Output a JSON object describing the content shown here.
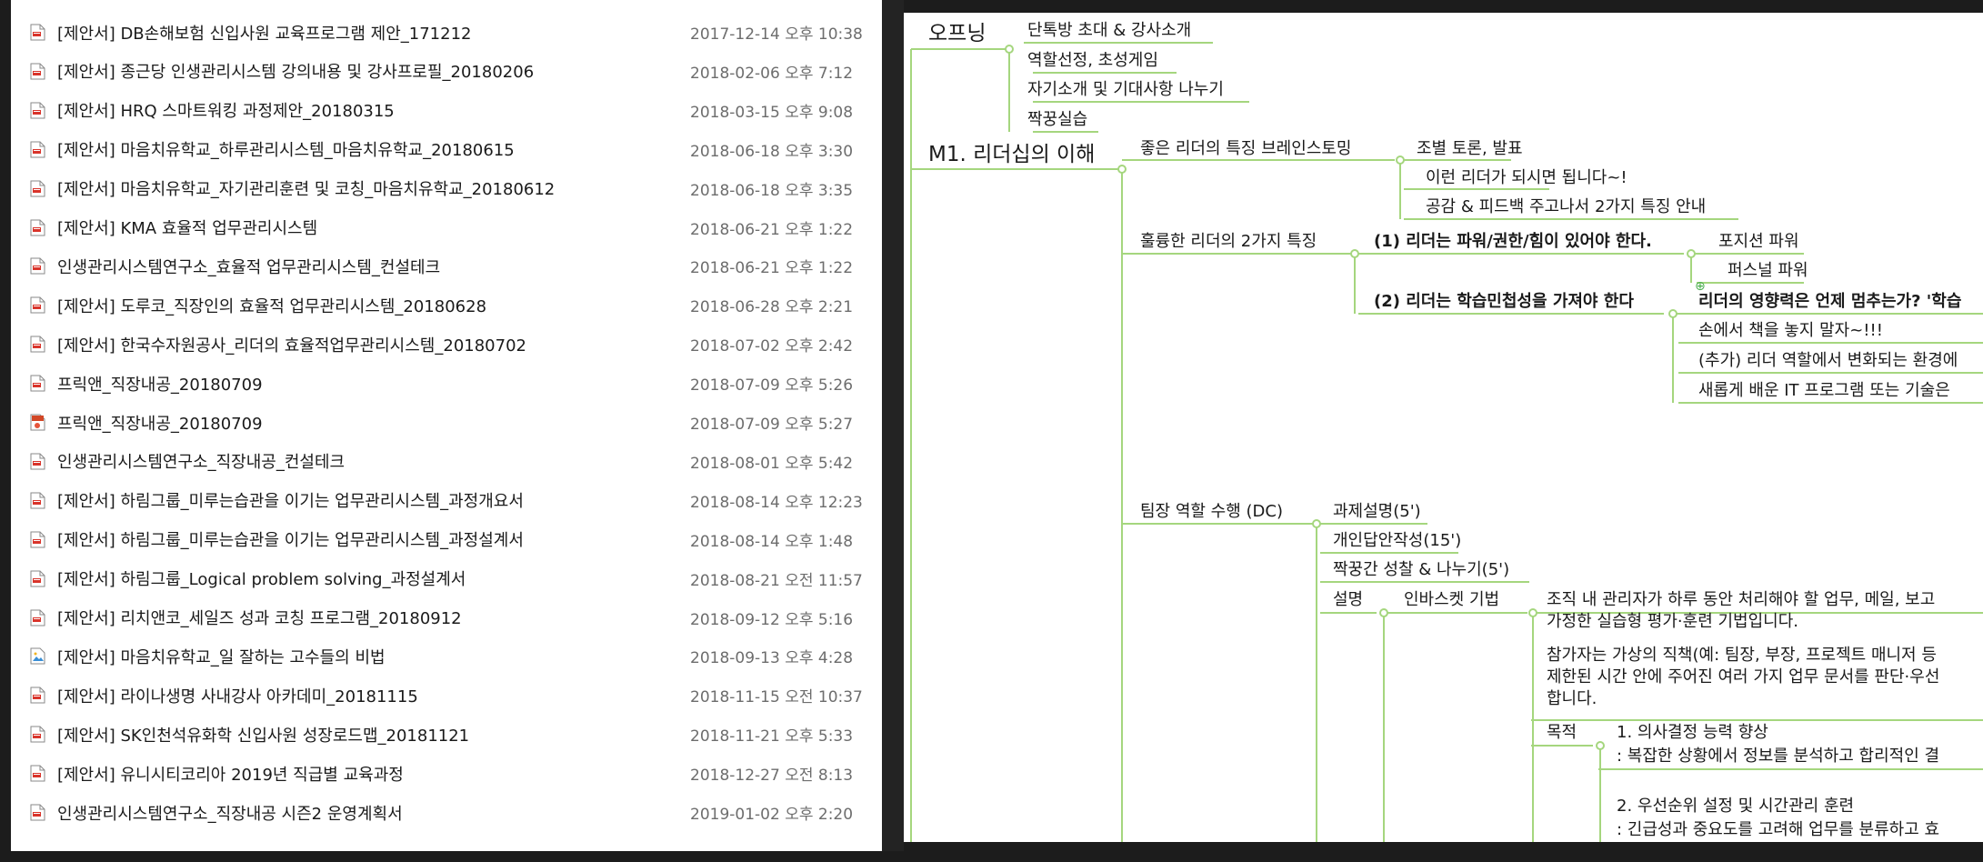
{
  "file_list": [
    {
      "name": "[제안서] DB손해보험 신입사원 교육프로그램 제안_171212",
      "date": "2017-12-14 오후 10:38",
      "icon": "pdf-file-icon"
    },
    {
      "name": "[제안서] 종근당 인생관리시스템 강의내용 및 강사프로필_20180206",
      "date": "2018-02-06 오후 7:12",
      "icon": "pdf-file-icon"
    },
    {
      "name": "[제안서] HRQ 스마트워킹 과정제안_20180315",
      "date": "2018-03-15 오후 9:08",
      "icon": "pdf-file-icon"
    },
    {
      "name": "[제안서] 마음치유학교_하루관리시스템_마음치유학교_20180615",
      "date": "2018-06-18 오후 3:30",
      "icon": "pdf-file-icon"
    },
    {
      "name": "[제안서] 마음치유학교_자기관리훈련 및 코칭_마음치유학교_20180612",
      "date": "2018-06-18 오후 3:35",
      "icon": "pdf-file-icon"
    },
    {
      "name": "[제안서] KMA 효율적 업무관리시스템",
      "date": "2018-06-21 오후 1:22",
      "icon": "pdf-file-icon"
    },
    {
      "name": "인생관리시스템연구소_효율적 업무관리시스템_컨설테크",
      "date": "2018-06-21 오후 1:22",
      "icon": "pdf-file-icon"
    },
    {
      "name": "[제안서] 도루코_직장인의 효율적 업무관리시스템_20180628",
      "date": "2018-06-28 오후 2:21",
      "icon": "pdf-file-icon"
    },
    {
      "name": "[제안서] 한국수자원공사_리더의 효율적업무관리시스템_20180702",
      "date": "2018-07-02 오후 2:42",
      "icon": "pdf-file-icon"
    },
    {
      "name": "프릭앤_직장내공_20180709",
      "date": "2018-07-09 오후 5:26",
      "icon": "pdf-file-icon"
    },
    {
      "name": "프릭앤_직장내공_20180709",
      "date": "2018-07-09 오후 5:27",
      "icon": "ppt-file-icon"
    },
    {
      "name": "인생관리시스템연구소_직장내공_컨설테크",
      "date": "2018-08-01 오후 5:42",
      "icon": "pdf-file-icon"
    },
    {
      "name": "[제안서] 하림그룹_미루는습관을 이기는 업무관리시스템_과정개요서",
      "date": "2018-08-14 오후 12:23",
      "icon": "pdf-file-icon"
    },
    {
      "name": "[제안서] 하림그룹_미루는습관을 이기는 업무관리시스템_과정설계서",
      "date": "2018-08-14 오후 1:48",
      "icon": "pdf-file-icon"
    },
    {
      "name": "[제안서] 하림그룹_Logical problem solving_과정설계서",
      "date": "2018-08-21 오전 11:57",
      "icon": "pdf-file-icon"
    },
    {
      "name": "[제안서] 리치앤코_세일즈 성과 코칭 프로그램_20180912",
      "date": "2018-09-12 오후 5:16",
      "icon": "pdf-file-icon"
    },
    {
      "name": "[제안서] 마음치유학교_일 잘하는 고수들의 비법",
      "date": "2018-09-13 오후 4:28",
      "icon": "image-file-icon"
    },
    {
      "name": "[제안서] 라이나생명 사내강사 아카데미_20181115",
      "date": "2018-11-15 오전 10:37",
      "icon": "pdf-file-icon"
    },
    {
      "name": "[제안서] SK인천석유화학 신입사원 성장로드맵_20181121",
      "date": "2018-11-21 오후 5:33",
      "icon": "pdf-file-icon"
    },
    {
      "name": "[제안서] 유니시티코리아 2019년 직급별 교육과정",
      "date": "2018-12-27 오전 8:13",
      "icon": "pdf-file-icon"
    },
    {
      "name": "인생관리시스템연구소_직장내공 시즌2 운영계획서",
      "date": "2019-01-02 오후 2:20",
      "icon": "pdf-file-icon"
    }
  ],
  "mindmap": {
    "line_color": "#a5d67e",
    "nodes": {
      "opening": "오프닝",
      "opening_c1": "단톡방 초대 & 강사소개",
      "opening_c2": "역할선정, 초성게임",
      "opening_c3": "자기소개 및 기대사항 나누기",
      "opening_c4": "짝꿍실습",
      "m1": "M1. 리더십의 이해",
      "m1_a": "좋은 리더의 특징 브레인스토밍",
      "m1_a1": "조별 토론, 발표",
      "m1_a2": "이런 리더가 되시면 됩니다~!",
      "m1_a3": "공감 & 피드백 주고나서 2가지 특징 안내",
      "m1_b": "훌륭한 리더의 2가지 특징",
      "m1_b1": "(1) 리더는 파워/권한/힘이 있어야 한다.",
      "m1_b1a": "포지션 파워",
      "m1_b1b": "퍼스널 파워",
      "m1_b2": "(2) 리더는 학습민첩성을 가져야 한다",
      "m1_b2a": "리더의 영향력은 언제 멈추는가? '학습",
      "m1_b2b": "손에서 책을 놓지 말자~!!!",
      "m1_b2c": "(추가) 리더 역할에서 변화되는 환경에",
      "m1_b2d": "새롭게 배운 IT 프로그램 또는 기술은",
      "m1_c": "팀장 역할 수행 (DC)",
      "m1_c1": "과제설명(5')",
      "m1_c2": "개인답안작성(15')",
      "m1_c3": "짝꿍간 성찰 & 나누기(5')",
      "m1_c4": "설명",
      "inbasket": "인바스켓 기법",
      "inbasket_d1_l1": "조직 내 관리자가 하루 동안 처리해야 할 업무, 메일, 보고",
      "inbasket_d1_l2": "가정한 실습형 평가·훈련 기법입니다.",
      "inbasket_d2_l1": "참가자는 가상의 직책(예: 팀장, 부장, 프로젝트 매니저 등",
      "inbasket_d2_l2": "제한된 시간 안에 주어진 여러 가지 업무 문서를 판단·우선",
      "inbasket_d2_l3": "합니다.",
      "purpose": "목적",
      "purpose_1": "1. 의사결정 능력 향상",
      "purpose_1d": ": 복잡한 상황에서 정보를 분석하고 합리적인 결",
      "purpose_2": "2. 우선순위 설정 및 시간관리 훈련",
      "purpose_2d": ": 긴급성과 중요도를 고려해 업무를 분류하고 효"
    }
  }
}
